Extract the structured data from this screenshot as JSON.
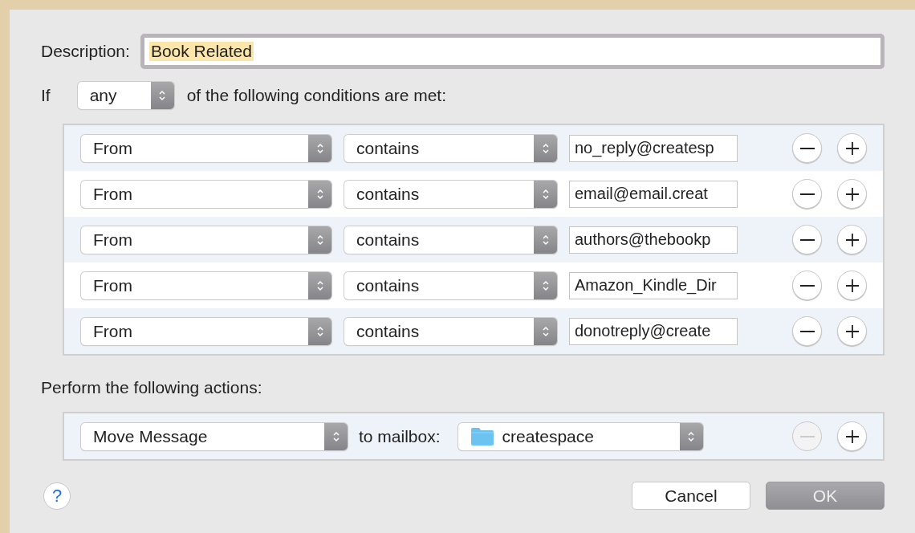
{
  "description": {
    "label": "Description:",
    "value": "Book Related",
    "text_selected": true
  },
  "match": {
    "prefix": "If",
    "value": "any",
    "suffix": "of the following conditions are met:"
  },
  "conditions": [
    {
      "field": "From",
      "operator": "contains",
      "value": "no_reply@createsp"
    },
    {
      "field": "From",
      "operator": "contains",
      "value": "email@email.creat"
    },
    {
      "field": "From",
      "operator": "contains",
      "value": "authors@thebookp"
    },
    {
      "field": "From",
      "operator": "contains",
      "value": "Amazon_Kindle_Dir"
    },
    {
      "field": "From",
      "operator": "contains",
      "value": "donotreply@create"
    }
  ],
  "actions_heading": "Perform the following actions:",
  "actions": [
    {
      "action": "Move Message",
      "target_label": "to mailbox:",
      "mailbox": "createspace",
      "remove_disabled": true
    }
  ],
  "help": "?",
  "buttons": [
    {
      "label": "Cancel",
      "disabled": false
    },
    {
      "label": "OK",
      "disabled": true
    }
  ]
}
